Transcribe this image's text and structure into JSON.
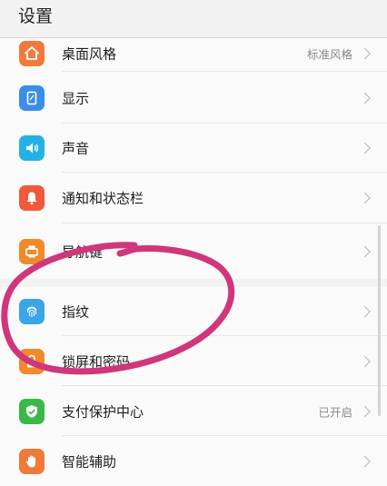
{
  "header": {
    "title": "设置"
  },
  "colors": {
    "home_icon": "#f07a3a",
    "display_icon": "#3a8ee6",
    "sound_icon": "#24b1e6",
    "notify_icon": "#f05a3a",
    "nav_icon": "#f08a2a",
    "fingerprint_icon": "#3aa6e6",
    "lock_icon": "#f08a2a",
    "payment_icon": "#3ab84a",
    "assist_icon": "#f07a3a",
    "annotation": "#d0367a"
  },
  "group1": {
    "items": [
      {
        "label": "桌面风格",
        "value": "标准风格",
        "icon": "home-icon"
      },
      {
        "label": "显示",
        "value": "",
        "icon": "display-icon"
      },
      {
        "label": "声音",
        "value": "",
        "icon": "speaker-icon"
      },
      {
        "label": "通知和状态栏",
        "value": "",
        "icon": "bell-icon"
      },
      {
        "label": "导航键",
        "value": "",
        "icon": "navigation-key-icon"
      }
    ]
  },
  "group2": {
    "items": [
      {
        "label": "指纹",
        "value": "",
        "icon": "fingerprint-icon"
      },
      {
        "label": "锁屏和密码",
        "value": "",
        "icon": "lock-icon"
      },
      {
        "label": "支付保护中心",
        "value": "已开启",
        "icon": "shield-check-icon"
      },
      {
        "label": "智能辅助",
        "value": "",
        "icon": "hand-icon"
      }
    ]
  }
}
